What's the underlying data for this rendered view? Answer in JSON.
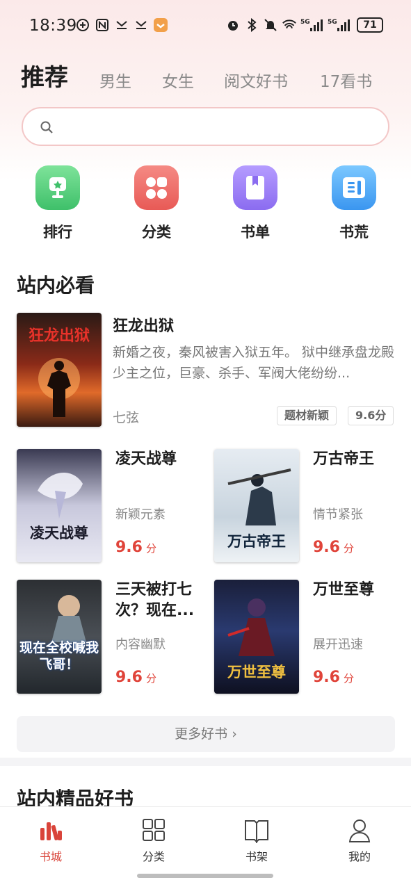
{
  "status_bar": {
    "time": "18:39",
    "battery": "71",
    "signal1": "5G",
    "signal2": "5G"
  },
  "tabs": [
    {
      "label": "推荐",
      "active": true
    },
    {
      "label": "男生"
    },
    {
      "label": "女生"
    },
    {
      "label": "阅文好书"
    },
    {
      "label": "17看书"
    }
  ],
  "search": {
    "placeholder": ""
  },
  "quick_entries": [
    {
      "label": "排行",
      "icon": "trophy-icon",
      "color": "#4fd27a"
    },
    {
      "label": "分类",
      "icon": "grid-icon",
      "color": "#f06a6a"
    },
    {
      "label": "书单",
      "icon": "booklist-icon",
      "color": "#9b7cf5"
    },
    {
      "label": "书荒",
      "icon": "book-icon",
      "color": "#4aa8f5"
    }
  ],
  "section1": {
    "title": "站内必看",
    "featured": {
      "title": "狂龙出狱",
      "description": "新婚之夜，秦风被害入狱五年。 狱中继承盘龙殿少主之位，巨豪、杀手、军阀大佬纷纷...",
      "author": "七弦",
      "tag": "题材新颖",
      "score": "9.6分",
      "cover_text": "狂龙出狱"
    },
    "grid": [
      {
        "title": "凌天战尊",
        "desc": "新颖元素",
        "score": "9.6",
        "unit": "分",
        "cover_text": "凌天战尊"
      },
      {
        "title": "万古帝王",
        "desc": "情节紧张",
        "score": "9.6",
        "unit": "分",
        "cover_text": "万古帝王"
      },
      {
        "title": "三天被打七次？现在...",
        "desc": "内容幽默",
        "score": "9.6",
        "unit": "分",
        "cover_text": "现在全校喊我飞哥！"
      },
      {
        "title": "万世至尊",
        "desc": "展开迅速",
        "score": "9.6",
        "unit": "分",
        "cover_text": "万世至尊"
      }
    ],
    "more_label": "更多好书 ›"
  },
  "section2": {
    "title": "站内精品好书"
  },
  "bottom_nav": [
    {
      "label": "书城",
      "icon": "bookstore-icon",
      "active": true
    },
    {
      "label": "分类",
      "icon": "category-icon"
    },
    {
      "label": "书架",
      "icon": "bookshelf-icon"
    },
    {
      "label": "我的",
      "icon": "profile-icon"
    }
  ],
  "colors": {
    "accent": "#e0443a",
    "search_border": "#f3c7c7"
  }
}
